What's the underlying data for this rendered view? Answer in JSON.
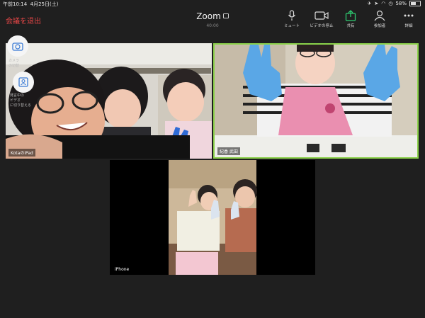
{
  "status": {
    "time": "午前10:14",
    "date": "4月25日(土)",
    "battery": "58%",
    "battery_level": 0.58
  },
  "header": {
    "leave_label": "会議を退出",
    "title": "Zoom",
    "timer": "40:00"
  },
  "toolbar": [
    {
      "name": "mute",
      "label": "ミュート",
      "icon": "microphone-icon"
    },
    {
      "name": "stop-video",
      "label": "ビデオの停止",
      "icon": "camera-icon"
    },
    {
      "name": "share",
      "label": "共有",
      "icon": "share-icon",
      "color": "#2ecc71"
    },
    {
      "name": "participants",
      "label": "参加者",
      "icon": "participants-icon"
    },
    {
      "name": "more",
      "label": "詳細",
      "icon": "more-dots-icon"
    }
  ],
  "tiles": [
    {
      "name": "tile-kota-ipad",
      "label": "KotaのiPad"
    },
    {
      "name": "tile-takeda",
      "label": "紀香 武田"
    },
    {
      "name": "tile-iphone",
      "label": "iPhone"
    }
  ],
  "float_hints": {
    "camera_switch": "カメラ\nの切替",
    "speaker_view": "発言中の\nビデオ\nに切り替える"
  },
  "colors": {
    "active_speaker_border": "#8bd14a",
    "leave": "#e24646"
  }
}
